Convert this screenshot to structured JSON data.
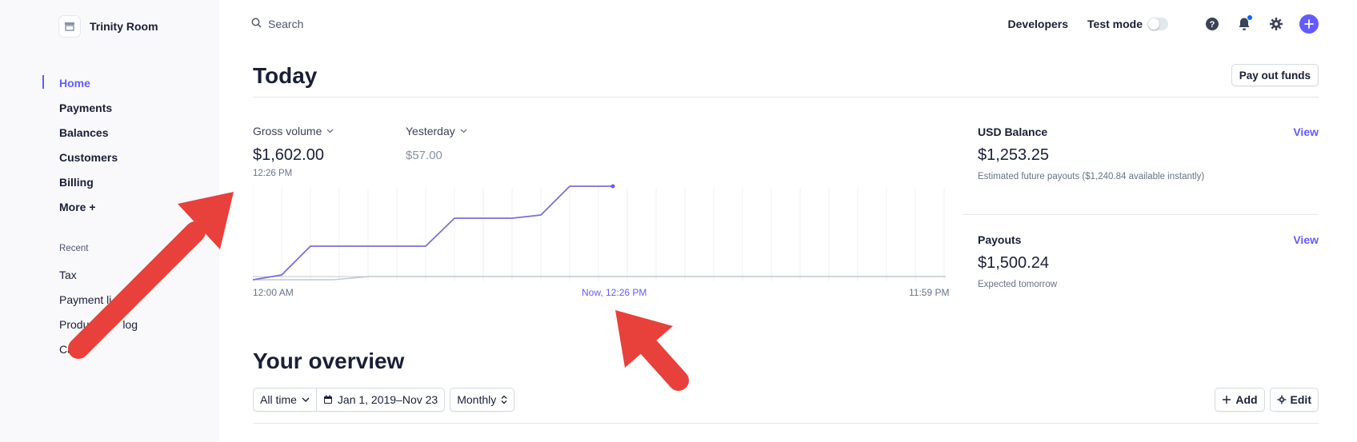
{
  "account": {
    "name": "Trinity Room"
  },
  "search": {
    "placeholder": "Search"
  },
  "topbar": {
    "developers": "Developers",
    "test_mode": "Test mode"
  },
  "sidebar": {
    "items": [
      {
        "label": "Home",
        "active": true
      },
      {
        "label": "Payments"
      },
      {
        "label": "Balances"
      },
      {
        "label": "Customers"
      },
      {
        "label": "Billing"
      },
      {
        "label": "More +"
      }
    ],
    "recent_title": "Recent",
    "recent": [
      {
        "label": "Tax"
      },
      {
        "label": "Payment li"
      },
      {
        "label": "Produ"
      },
      {
        "label": "Ca"
      }
    ],
    "recent_tails": [
      "",
      "",
      "log",
      ""
    ]
  },
  "today": {
    "title": "Today",
    "pay_out_label": "Pay out funds",
    "gross_volume": {
      "label": "Gross volume",
      "value": "$1,602.00",
      "time": "12:26 PM"
    },
    "yesterday": {
      "label": "Yesterday",
      "value": "$57.00"
    },
    "axis": {
      "start": "12:00 AM",
      "now": "Now, 12:26 PM",
      "end": "11:59 PM"
    }
  },
  "balance": {
    "usd_label": "USD Balance",
    "usd_link": "View",
    "usd_value": "$1,253.25",
    "usd_sub": "Estimated future payouts ($1,240.84 available instantly)",
    "payouts_label": "Payouts",
    "payouts_link": "View",
    "payouts_value": "$1,500.24",
    "payouts_sub": "Expected tomorrow"
  },
  "overview": {
    "title": "Your overview",
    "range_label": "All time",
    "date_range": "Jan 1, 2019–Nov 23",
    "interval": "Monthly",
    "add_label": "Add",
    "edit_label": "Edit"
  },
  "colors": {
    "accent": "#635bff",
    "arrow": "#e8403a"
  },
  "icons": [
    "store-icon",
    "search-icon",
    "help-icon",
    "bell-icon",
    "gear-icon",
    "plus-icon",
    "chevron-down-icon",
    "calendar-icon",
    "sort-icon",
    "arrow-annotation-icon"
  ]
}
